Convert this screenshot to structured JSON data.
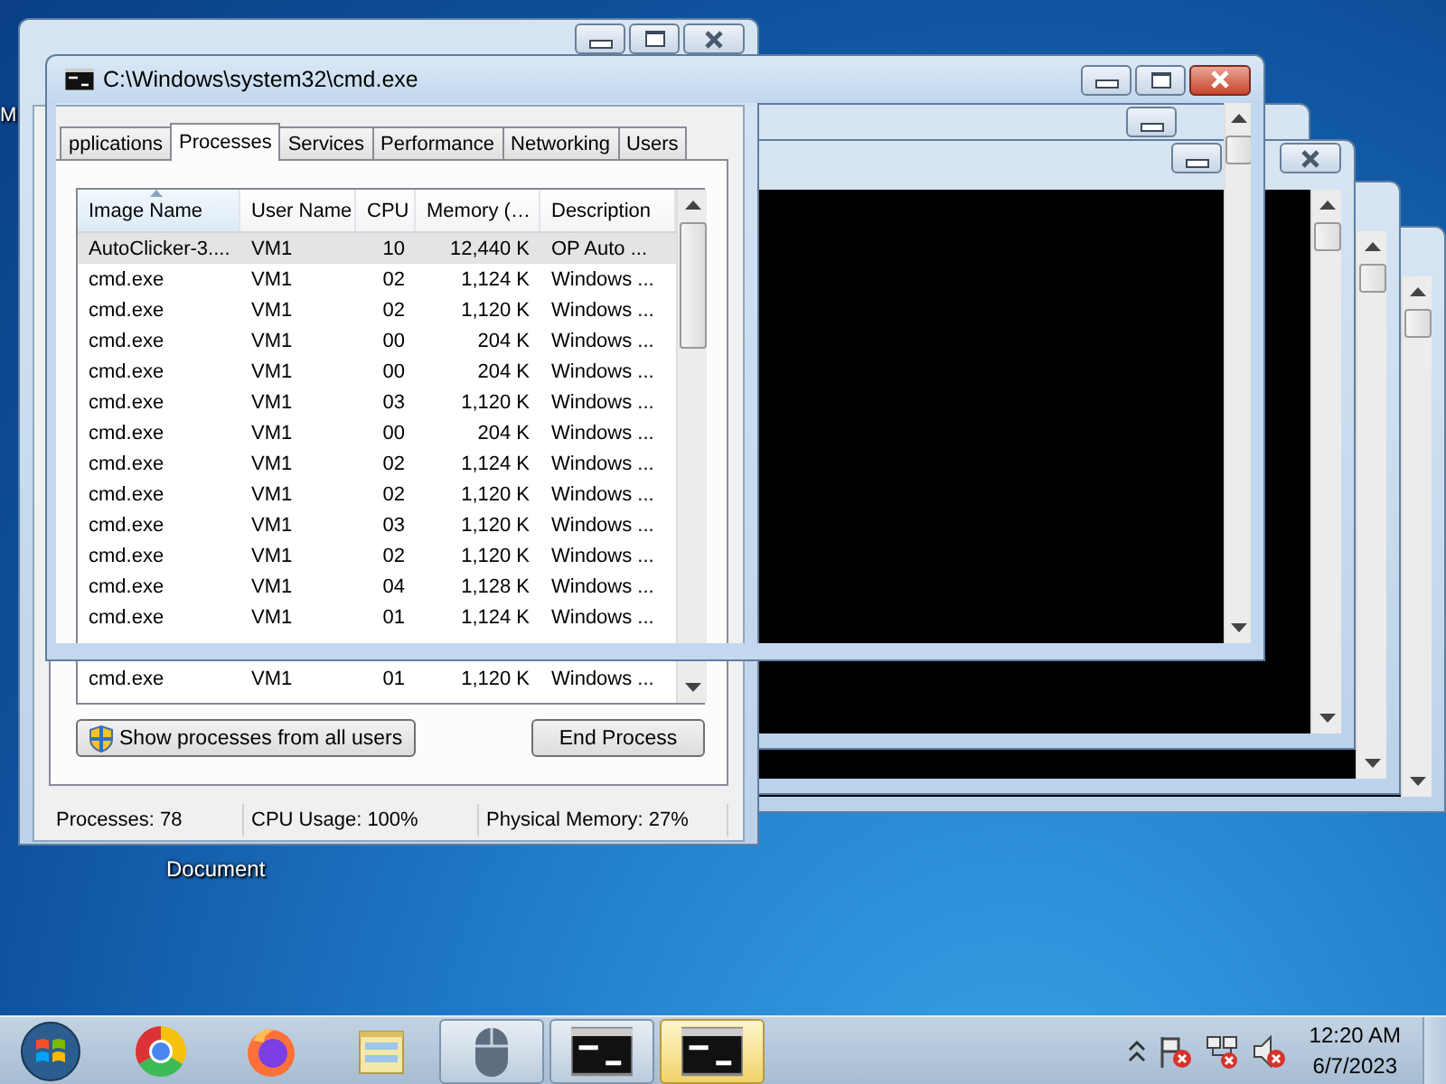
{
  "desktop_icons": [
    {
      "label": "M",
      "kind": "top"
    },
    {
      "label": "Document",
      "kind": "bottom"
    }
  ],
  "task_manager": {
    "tabs": [
      {
        "label": "pplications",
        "selected": false
      },
      {
        "label": "Processes",
        "selected": true
      },
      {
        "label": "Services",
        "selected": false
      },
      {
        "label": "Performance",
        "selected": false
      },
      {
        "label": "Networking",
        "selected": false
      },
      {
        "label": "Users",
        "selected": false
      }
    ],
    "table": {
      "columns": [
        {
          "label": "Image Name",
          "sorted": true
        },
        {
          "label": "User Name",
          "sorted": false
        },
        {
          "label": "CPU",
          "sorted": false
        },
        {
          "label": "Memory (…",
          "sorted": false
        },
        {
          "label": "Description",
          "sorted": false
        }
      ],
      "rows": [
        {
          "selected": true,
          "cells": [
            "AutoClicker-3....",
            "VM1",
            "10",
            "12,440 K",
            "OP Auto ..."
          ]
        },
        {
          "selected": false,
          "cells": [
            "cmd.exe",
            "VM1",
            "02",
            "1,124 K",
            "Windows ..."
          ]
        },
        {
          "selected": false,
          "cells": [
            "cmd.exe",
            "VM1",
            "02",
            "1,120 K",
            "Windows ..."
          ]
        },
        {
          "selected": false,
          "cells": [
            "cmd.exe",
            "VM1",
            "00",
            "204 K",
            "Windows ..."
          ]
        },
        {
          "selected": false,
          "cells": [
            "cmd.exe",
            "VM1",
            "00",
            "204 K",
            "Windows ..."
          ]
        },
        {
          "selected": false,
          "cells": [
            "cmd.exe",
            "VM1",
            "03",
            "1,120 K",
            "Windows ..."
          ]
        },
        {
          "selected": false,
          "cells": [
            "cmd.exe",
            "VM1",
            "00",
            "204 K",
            "Windows ..."
          ]
        },
        {
          "selected": false,
          "cells": [
            "cmd.exe",
            "VM1",
            "02",
            "1,124 K",
            "Windows ..."
          ]
        },
        {
          "selected": false,
          "cells": [
            "cmd.exe",
            "VM1",
            "02",
            "1,120 K",
            "Windows ..."
          ]
        },
        {
          "selected": false,
          "cells": [
            "cmd.exe",
            "VM1",
            "03",
            "1,120 K",
            "Windows ..."
          ]
        },
        {
          "selected": false,
          "cells": [
            "cmd.exe",
            "VM1",
            "02",
            "1,120 K",
            "Windows ..."
          ]
        },
        {
          "selected": false,
          "cells": [
            "cmd.exe",
            "VM1",
            "04",
            "1,128 K",
            "Windows ..."
          ]
        },
        {
          "selected": false,
          "cells": [
            "cmd.exe",
            "VM1",
            "01",
            "1,124 K",
            "Windows ..."
          ]
        }
      ],
      "rows_below_overlap": [
        {
          "selected": false,
          "cells": [
            "cmd.exe",
            "VM1",
            "01",
            "1,120 K",
            "Windows ..."
          ]
        }
      ]
    },
    "buttons": [
      {
        "label": "Show processes from all users",
        "kind": "shield"
      },
      {
        "label": "End Process",
        "kind": "plain"
      }
    ],
    "status_bar": [
      "Processes: 78",
      "CPU Usage: 100%",
      "Physical Memory: 27%"
    ]
  },
  "console_window": {
    "title": "C:\\Windows\\system32\\cmd.exe"
  },
  "taskbar": {
    "items": [
      {
        "kind": "ring",
        "running": false,
        "selected": false
      },
      {
        "kind": "fox",
        "running": false,
        "selected": false
      },
      {
        "kind": "folder",
        "running": false,
        "selected": false
      },
      {
        "kind": "mouse",
        "running": true,
        "selected": false
      },
      {
        "kind": "console",
        "running": true,
        "selected": false
      },
      {
        "kind": "console",
        "running": true,
        "selected": true
      }
    ],
    "clock": {
      "time": "12:20 AM",
      "date": "6/7/2023"
    }
  }
}
